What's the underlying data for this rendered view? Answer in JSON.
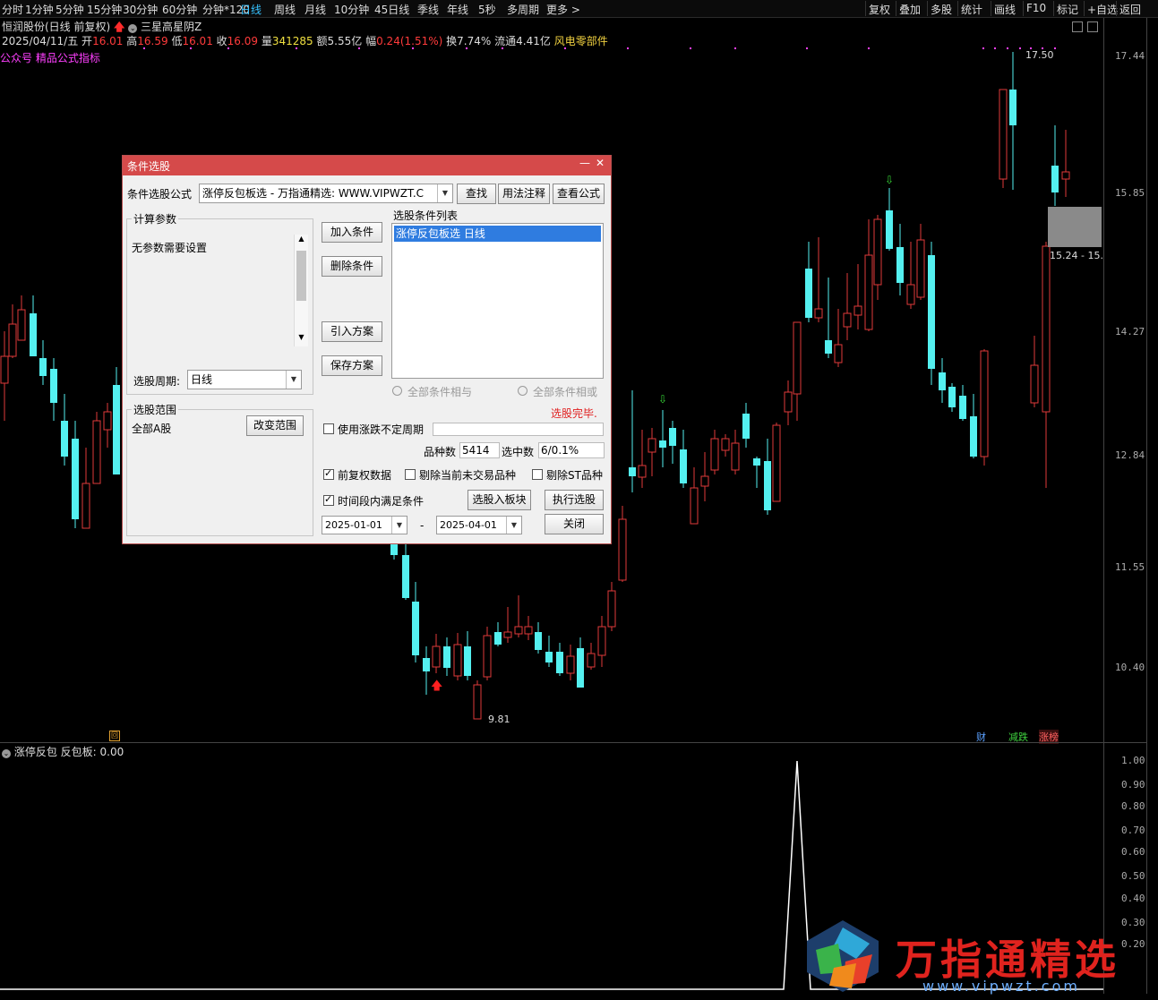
{
  "toolbar": {
    "timeframes": [
      "分时",
      "1分钟",
      "5分钟",
      "15分钟",
      "30分钟",
      "60分钟",
      "分钟*120",
      "日线",
      "周线",
      "月线",
      "10分钟",
      "45日线",
      "季线",
      "年线",
      "5秒",
      "多周期",
      "更多 >"
    ],
    "active": "日线",
    "right_items": [
      "复权",
      "叠加",
      "多股",
      "统计",
      "画线",
      "F10",
      "标记",
      "+自选",
      "返回"
    ]
  },
  "stock": {
    "title": "恒润股份(日线 前复权)",
    "pattern": "三星高星阴Z",
    "date": "2025/04/11/五",
    "open_label": "开",
    "open": "16.01",
    "high_label": "高",
    "high": "16.59",
    "low_label": "低",
    "low": "16.01",
    "close_label": "收",
    "close": "16.09",
    "volume_label": "量",
    "volume": "341285",
    "amount_label": "额",
    "amount": "5.55亿",
    "change_label": "幅",
    "change": "0.24(1.51%)",
    "turnover_label": "换",
    "turnover": "7.74%",
    "float_label": "流通",
    "float": "4.41亿",
    "sector": "风电零部件",
    "formula_line": "公众号 精品公式指标"
  },
  "price_axis": [
    "17.44",
    "15.85",
    "14.27",
    "12.84",
    "11.55",
    "10.40"
  ],
  "annotations": {
    "high_mark": "17.50",
    "low_mark": "9.81",
    "range_box": "15.24 - 15."
  },
  "bottom_badges": [
    "财",
    "减跌",
    "涨榜"
  ],
  "indicator": {
    "name": "涨停反包",
    "label": "反包板: 0.00",
    "axis": [
      "1.00",
      "0.90",
      "0.80",
      "0.70",
      "0.60",
      "0.50",
      "0.40",
      "0.30",
      "0.20"
    ]
  },
  "dialog": {
    "title": "条件选股",
    "formula_label": "条件选股公式",
    "formula_value": "涨停反包板选  -  万指通精选: WWW.VIPWZT.C",
    "find_button": "查找",
    "usage_button": "用法注释",
    "view_button": "查看公式",
    "params_group": "计算参数",
    "params_text": "无参数需要设置",
    "period_label": "选股周期:",
    "period_value": "日线",
    "range_group": "选股范围",
    "range_value": "全部A股",
    "change_range_button": "改变范围",
    "add_button": "加入条件",
    "delete_button": "删除条件",
    "import_button": "引入方案",
    "save_button": "保存方案",
    "list_label": "选股条件列表",
    "list_items": [
      "涨停反包板选  日线"
    ],
    "radio_and": "全部条件相与",
    "radio_or": "全部条件相或",
    "status": "选股完毕.",
    "use_irregular": "使用涨跌不定周期",
    "count_label": "品种数",
    "count_value": "5414",
    "selected_label": "选中数",
    "selected_value": "6/0.1%",
    "cb_fq": "前复权数据",
    "cb_exclude_untraded": "剔除当前未交易品种",
    "cb_exclude_st": "剔除ST品种",
    "cb_time": "时间段内满足条件",
    "to_block_button": "选股入板块",
    "run_button": "执行选股",
    "date_from": "2025-01-01",
    "dash": "-",
    "date_to": "2025-04-01",
    "close_button": "关闭"
  },
  "watermark": {
    "title": "万指通精选",
    "url": "www.vipwzt.com"
  },
  "colors": {
    "up": "#e03a3a",
    "down": "#54f0f0",
    "accent": "#36c2ff",
    "dialog_title": "#d54a4a"
  }
}
